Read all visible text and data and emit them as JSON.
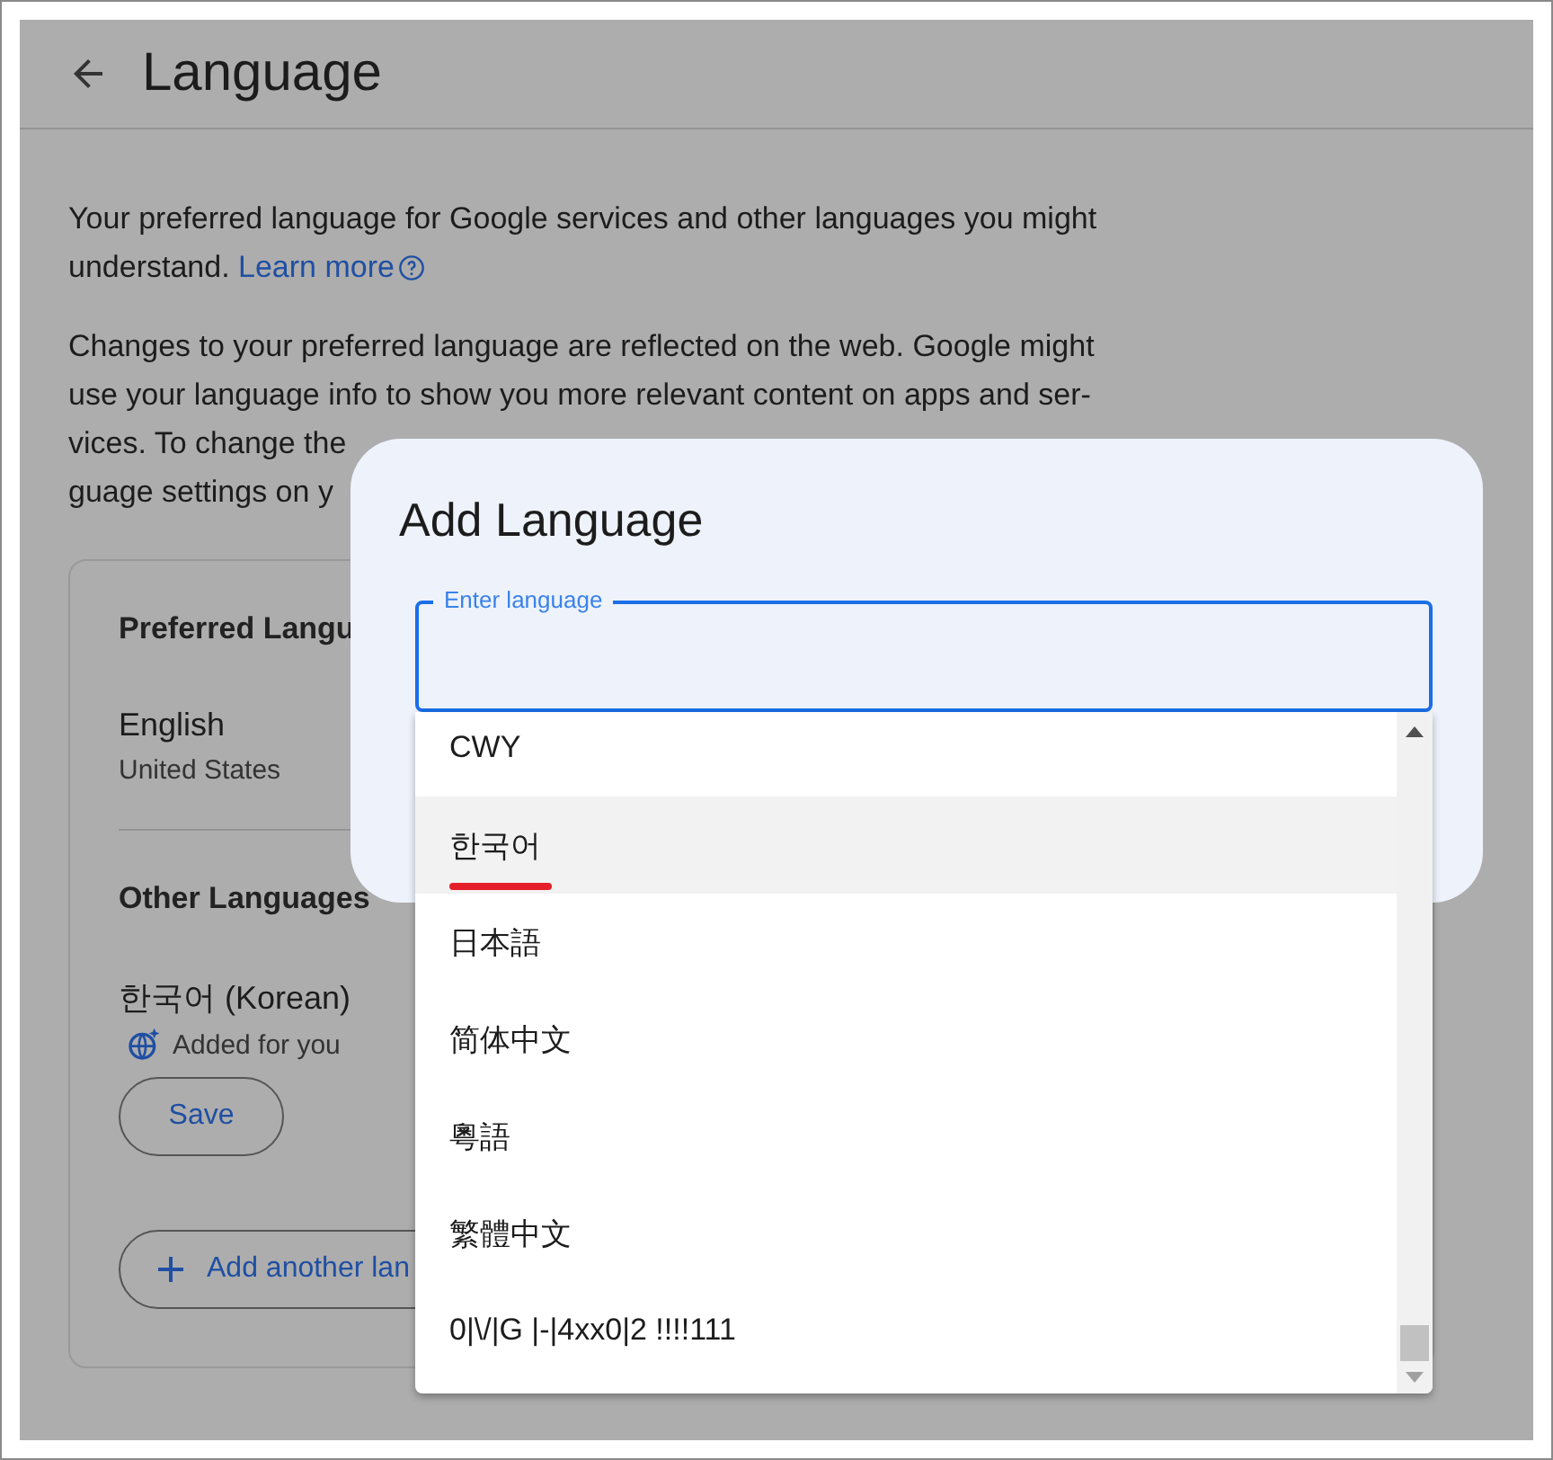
{
  "header": {
    "title": "Language"
  },
  "intro": {
    "text": "Your preferred language for Google services and other languages you might understand.",
    "link": "Learn more"
  },
  "note_lines": [
    "Changes to your preferred language are reflected on the web. Google might",
    "use your language info to show you more relevant content on apps and ser-",
    "vices. To change the",
    "guage settings on y"
  ],
  "preferred": {
    "heading": "Preferred Langu",
    "language": "English",
    "region": "United States"
  },
  "other": {
    "heading": "Other Languages",
    "language": "한국어 (Korean)",
    "badge": "Added for you",
    "button": "Save"
  },
  "add_button": "Add another lan",
  "dialog": {
    "title": "Add Language",
    "field": {
      "label": "Enter language"
    }
  },
  "options": [
    {
      "label": "CWY",
      "selected": false,
      "underlined": false
    },
    {
      "label": "한국어",
      "selected": true,
      "underlined": true
    },
    {
      "label": "日本語",
      "selected": false,
      "underlined": false
    },
    {
      "label": "简体中文",
      "selected": false,
      "underlined": false
    },
    {
      "label": "粵語",
      "selected": false,
      "underlined": false
    },
    {
      "label": "繁體中文",
      "selected": false,
      "underlined": false
    },
    {
      "label": "0|\\/|G |-|4xx0|2 !!!!111",
      "selected": false,
      "underlined": false
    }
  ]
}
